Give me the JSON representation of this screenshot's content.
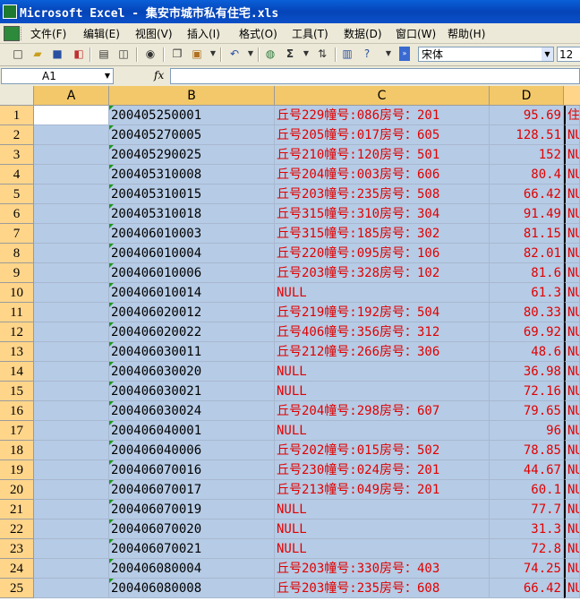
{
  "window": {
    "title": "Microsoft Excel - 集安市城市私有住宅.xls"
  },
  "menu": [
    "文件(F)",
    "编辑(E)",
    "视图(V)",
    "插入(I)",
    "格式(O)",
    "工具(T)",
    "数据(D)",
    "窗口(W)",
    "帮助(H)"
  ],
  "toolbar": {
    "font_name": "宋体",
    "font_size": "12",
    "sigma": "Σ"
  },
  "formula_bar": {
    "name_box": "A1",
    "fx": "fx"
  },
  "columns": [
    "A",
    "B",
    "C",
    "D"
  ],
  "rows": [
    {
      "n": "1",
      "b": "200405250001",
      "c": "丘号229幢号:086房号：201",
      "d": "95.69",
      "e": "住"
    },
    {
      "n": "2",
      "b": "200405270005",
      "c": "丘号205幢号:017房号：605",
      "d": "128.51",
      "e": "NU"
    },
    {
      "n": "3",
      "b": "200405290025",
      "c": "丘号210幢号:120房号：501",
      "d": "152",
      "e": "NU"
    },
    {
      "n": "4",
      "b": "200405310008",
      "c": "丘号204幢号:003房号：606",
      "d": "80.4",
      "e": "NU"
    },
    {
      "n": "5",
      "b": "200405310015",
      "c": "丘号203幢号:235房号：508",
      "d": "66.42",
      "e": "NU"
    },
    {
      "n": "6",
      "b": "200405310018",
      "c": "丘号315幢号:310房号：304",
      "d": "91.49",
      "e": "NU"
    },
    {
      "n": "7",
      "b": "200406010003",
      "c": "丘号315幢号:185房号：302",
      "d": "81.15",
      "e": "NU"
    },
    {
      "n": "8",
      "b": "200406010004",
      "c": "丘号220幢号:095房号：106",
      "d": "82.01",
      "e": "NU"
    },
    {
      "n": "9",
      "b": "200406010006",
      "c": "丘号203幢号:328房号：102",
      "d": "81.6",
      "e": "NU"
    },
    {
      "n": "10",
      "b": "200406010014",
      "c": "NULL",
      "d": "61.3",
      "e": "NU"
    },
    {
      "n": "11",
      "b": "200406020012",
      "c": "丘号219幢号:192房号：504",
      "d": "80.33",
      "e": "NU"
    },
    {
      "n": "12",
      "b": "200406020022",
      "c": "丘号406幢号:356房号：312",
      "d": "69.92",
      "e": "NU"
    },
    {
      "n": "13",
      "b": "200406030011",
      "c": "丘号212幢号:266房号：306",
      "d": "48.6",
      "e": "NU"
    },
    {
      "n": "14",
      "b": "200406030020",
      "c": "NULL",
      "d": "36.98",
      "e": "NU"
    },
    {
      "n": "15",
      "b": "200406030021",
      "c": "NULL",
      "d": "72.16",
      "e": "NU"
    },
    {
      "n": "16",
      "b": "200406030024",
      "c": "丘号204幢号:298房号：607",
      "d": "79.65",
      "e": "NU"
    },
    {
      "n": "17",
      "b": "200406040001",
      "c": "NULL",
      "d": "96",
      "e": "NU"
    },
    {
      "n": "18",
      "b": "200406040006",
      "c": "丘号202幢号:015房号：502",
      "d": "78.85",
      "e": "NU"
    },
    {
      "n": "19",
      "b": "200406070016",
      "c": "丘号230幢号:024房号：201",
      "d": "44.67",
      "e": "NU"
    },
    {
      "n": "20",
      "b": "200406070017",
      "c": "丘号213幢号:049房号：201",
      "d": "60.1",
      "e": "NU"
    },
    {
      "n": "21",
      "b": "200406070019",
      "c": "NULL",
      "d": "77.7",
      "e": "NU"
    },
    {
      "n": "22",
      "b": "200406070020",
      "c": "NULL",
      "d": "31.3",
      "e": "NU"
    },
    {
      "n": "23",
      "b": "200406070021",
      "c": "NULL",
      "d": "72.8",
      "e": "NU"
    },
    {
      "n": "24",
      "b": "200406080004",
      "c": "丘号203幢号:330房号：403",
      "d": "74.25",
      "e": "NU"
    },
    {
      "n": "25",
      "b": "200406080008",
      "c": "丘号203幢号:235房号：608",
      "d": "66.42",
      "e": "NU"
    }
  ]
}
